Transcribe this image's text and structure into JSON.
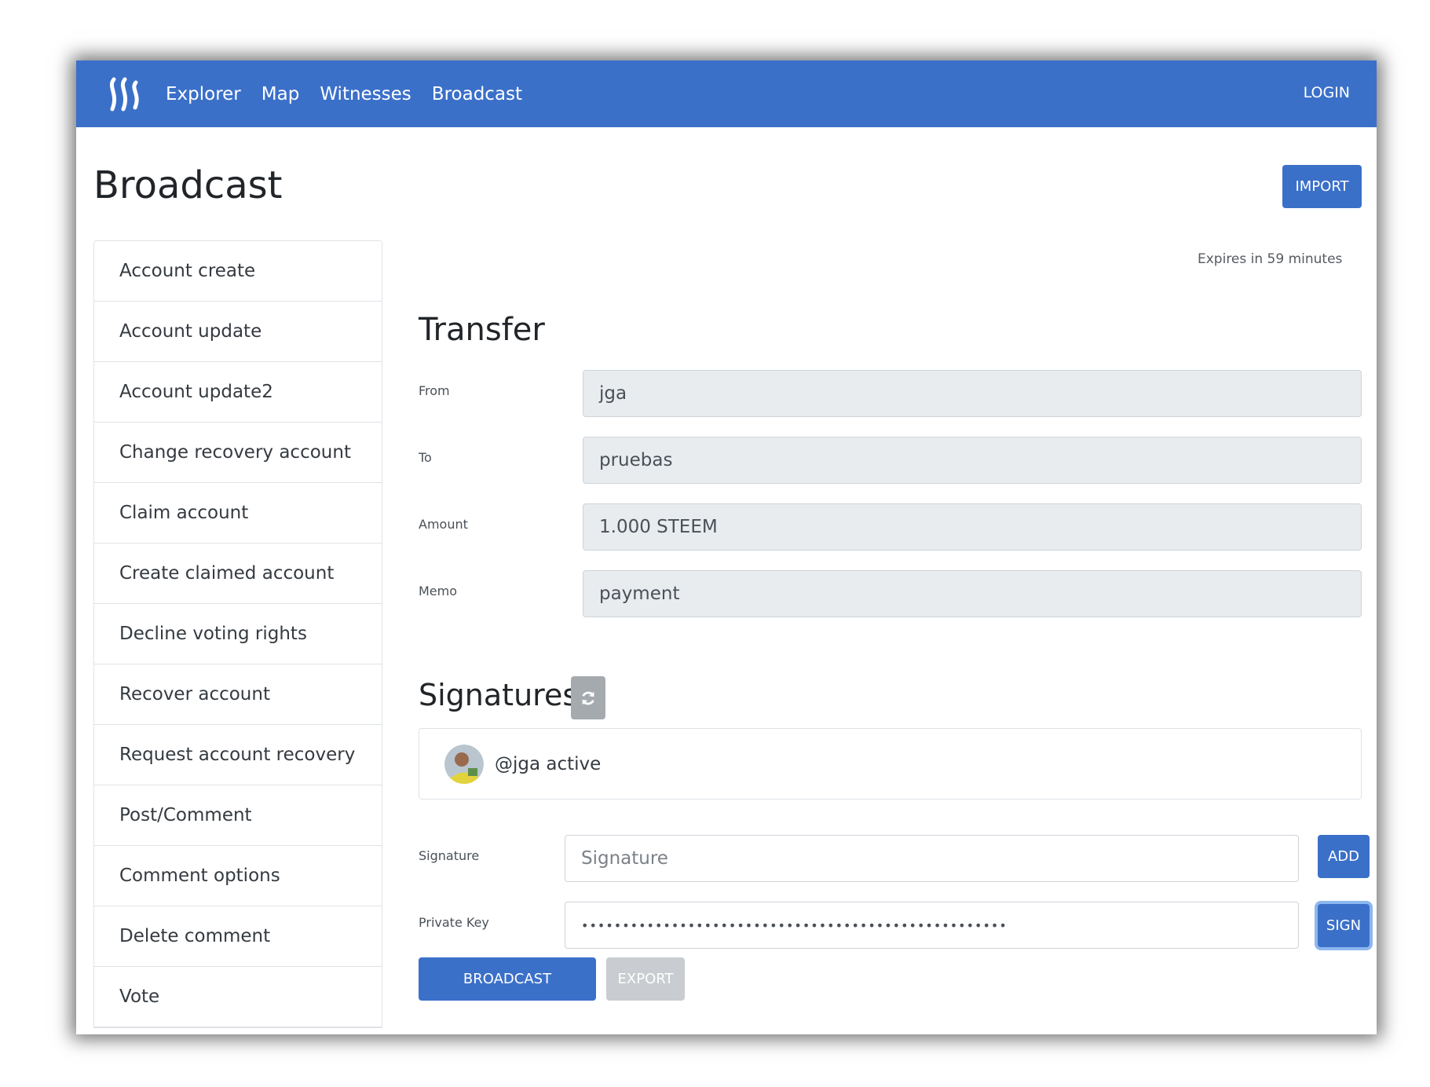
{
  "nav": {
    "logo_icon": "steem-logo-icon",
    "links": [
      "Explorer",
      "Map",
      "Witnesses",
      "Broadcast"
    ],
    "login": "LOGIN",
    "color": "#3b70c9"
  },
  "page": {
    "title": "Broadcast",
    "import_label": "IMPORT"
  },
  "sidebar": {
    "items": [
      "Account create",
      "Account update",
      "Account update2",
      "Change recovery account",
      "Claim account",
      "Create claimed account",
      "Decline voting rights",
      "Recover account",
      "Request account recovery",
      "Post/Comment",
      "Comment options",
      "Delete comment",
      "Vote"
    ]
  },
  "transfer": {
    "expires": "Expires in 59 minutes",
    "title": "Transfer",
    "fields": [
      {
        "label": "From",
        "value": "jga"
      },
      {
        "label": "To",
        "value": "pruebas"
      },
      {
        "label": "Amount",
        "value": "1.000 STEEM"
      },
      {
        "label": "Memo",
        "value": "payment"
      }
    ]
  },
  "signatures": {
    "title": "Signatures",
    "refresh_icon": "refresh-icon",
    "entry": "@jga active",
    "signature_label": "Signature",
    "signature_placeholder": "Signature",
    "add_label": "ADD",
    "private_key_label": "Private Key",
    "private_key_value": "••••••••••••••••••••••••••••••••••••••••••••••••••••",
    "sign_label": "SIGN"
  },
  "actions": {
    "broadcast_label": "BROADCAST",
    "export_label": "EXPORT"
  }
}
